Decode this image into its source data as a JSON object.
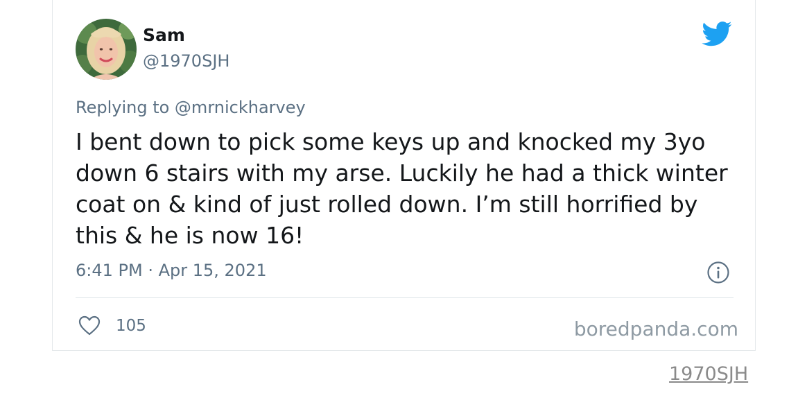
{
  "tweet": {
    "author": {
      "name": "Sam",
      "handle": "@1970SJH"
    },
    "reply_to": "Replying to @mrnickharvey",
    "text": "I bent down to pick some keys up and knocked my 3yo down 6 stairs with my arse. Luckily he had a thick winter coat on & kind of just rolled down. I’m still horrified by this & he is now 16!",
    "timestamp": "6:41 PM · Apr 15, 2021",
    "likes": "105",
    "watermark": "boredpanda.com"
  },
  "source_link": "1970SJH",
  "icons": {
    "brand": "twitter-bird-icon",
    "info": "info-icon",
    "like": "heart-icon"
  },
  "colors": {
    "twitter_blue": "#1da1f2",
    "primary_text": "#14171a",
    "secondary_text": "#5b7083",
    "watermark": "#8e9aa3"
  }
}
